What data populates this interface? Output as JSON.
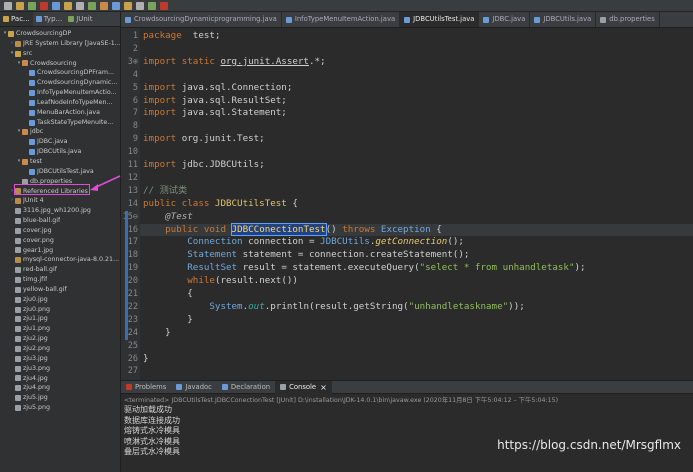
{
  "explorer": {
    "tabs": [
      {
        "label": "Pac...",
        "color": "#c9a24a"
      },
      {
        "label": "Typ...",
        "color": "#6a9bd8"
      },
      {
        "label": "JUnit",
        "color": "#7aa35a"
      }
    ],
    "tree": [
      {
        "depth": 0,
        "arrow": "▾",
        "icon": "project-icon",
        "color": "#c9a24a",
        "label": "CrowdsourcingDP"
      },
      {
        "depth": 1,
        "arrow": "›",
        "icon": "library-icon",
        "color": "#b88c4a",
        "label": "JRE System Library [JavaSE-1..."
      },
      {
        "depth": 1,
        "arrow": "▾",
        "icon": "folder-icon",
        "color": "#c9a24a",
        "label": "src"
      },
      {
        "depth": 2,
        "arrow": "▾",
        "icon": "package-icon",
        "color": "#c98a4a",
        "label": "Crowdsourcing"
      },
      {
        "depth": 3,
        "arrow": "",
        "icon": "java-file-icon",
        "color": "#6a9bd8",
        "label": "CrowdsourcingDPFram..."
      },
      {
        "depth": 3,
        "arrow": "",
        "icon": "java-file-icon",
        "color": "#6a9bd8",
        "label": "CrowdsourcingDynamic..."
      },
      {
        "depth": 3,
        "arrow": "",
        "icon": "java-file-icon",
        "color": "#6a9bd8",
        "label": "InfoTypeMenuItemActio..."
      },
      {
        "depth": 3,
        "arrow": "",
        "icon": "java-file-icon",
        "color": "#6a9bd8",
        "label": "LeafNodeInfoTypeMen..."
      },
      {
        "depth": 3,
        "arrow": "",
        "icon": "java-file-icon",
        "color": "#6a9bd8",
        "label": "MenuBarAction.java"
      },
      {
        "depth": 3,
        "arrow": "",
        "icon": "java-file-icon",
        "color": "#6a9bd8",
        "label": "TaskStateTypeMenuIte..."
      },
      {
        "depth": 2,
        "arrow": "▾",
        "icon": "package-icon",
        "color": "#c98a4a",
        "label": "jdbc"
      },
      {
        "depth": 3,
        "arrow": "",
        "icon": "java-file-icon",
        "color": "#6a9bd8",
        "label": "JDBC.java"
      },
      {
        "depth": 3,
        "arrow": "",
        "icon": "java-file-icon",
        "color": "#6a9bd8",
        "label": "JDBCUtils.java"
      },
      {
        "depth": 2,
        "arrow": "▾",
        "icon": "package-icon",
        "color": "#c98a4a",
        "label": "test"
      },
      {
        "depth": 3,
        "arrow": "",
        "icon": "java-file-icon",
        "color": "#6a9bd8",
        "label": "JDBCUtilsTest.java"
      },
      {
        "depth": 2,
        "arrow": "",
        "icon": "properties-file-icon",
        "color": "#9aa0a6",
        "label": "db.properties"
      },
      {
        "depth": 1,
        "arrow": "›",
        "icon": "library-icon",
        "color": "#b88c4a",
        "label": "Referenced Libraries"
      },
      {
        "depth": 1,
        "arrow": "›",
        "icon": "library-icon",
        "color": "#b88c4a",
        "label": "JUnit 4"
      },
      {
        "depth": 1,
        "arrow": "",
        "icon": "image-file-icon",
        "color": "#9aa0a6",
        "label": "3116.jpg_wh1200.jpg"
      },
      {
        "depth": 1,
        "arrow": "",
        "icon": "image-file-icon",
        "color": "#9aa0a6",
        "label": "blue-ball.gif"
      },
      {
        "depth": 1,
        "arrow": "",
        "icon": "image-file-icon",
        "color": "#9aa0a6",
        "label": "cover.jpg"
      },
      {
        "depth": 1,
        "arrow": "",
        "icon": "image-file-icon",
        "color": "#9aa0a6",
        "label": "cover.png"
      },
      {
        "depth": 1,
        "arrow": "",
        "icon": "image-file-icon",
        "color": "#9aa0a6",
        "label": "gear1.jpg"
      },
      {
        "depth": 1,
        "arrow": "",
        "icon": "jar-file-icon",
        "color": "#b88c4a",
        "label": "mysql-connector-java-8.0.21..."
      },
      {
        "depth": 1,
        "arrow": "",
        "icon": "image-file-icon",
        "color": "#9aa0a6",
        "label": "red-ball.gif"
      },
      {
        "depth": 1,
        "arrow": "",
        "icon": "image-file-icon",
        "color": "#9aa0a6",
        "label": "timg.jfif"
      },
      {
        "depth": 1,
        "arrow": "",
        "icon": "image-file-icon",
        "color": "#9aa0a6",
        "label": "yellow-ball.gif"
      },
      {
        "depth": 1,
        "arrow": "",
        "icon": "image-file-icon",
        "color": "#9aa0a6",
        "label": "zju0.jpg"
      },
      {
        "depth": 1,
        "arrow": "",
        "icon": "image-file-icon",
        "color": "#9aa0a6",
        "label": "zju0.png"
      },
      {
        "depth": 1,
        "arrow": "",
        "icon": "image-file-icon",
        "color": "#9aa0a6",
        "label": "zju1.jpg"
      },
      {
        "depth": 1,
        "arrow": "",
        "icon": "image-file-icon",
        "color": "#9aa0a6",
        "label": "zju1.png"
      },
      {
        "depth": 1,
        "arrow": "",
        "icon": "image-file-icon",
        "color": "#9aa0a6",
        "label": "zju2.jpg"
      },
      {
        "depth": 1,
        "arrow": "",
        "icon": "image-file-icon",
        "color": "#9aa0a6",
        "label": "zju2.png"
      },
      {
        "depth": 1,
        "arrow": "",
        "icon": "image-file-icon",
        "color": "#9aa0a6",
        "label": "zju3.jpg"
      },
      {
        "depth": 1,
        "arrow": "",
        "icon": "image-file-icon",
        "color": "#9aa0a6",
        "label": "zju3.png"
      },
      {
        "depth": 1,
        "arrow": "",
        "icon": "image-file-icon",
        "color": "#9aa0a6",
        "label": "zju4.jpg"
      },
      {
        "depth": 1,
        "arrow": "",
        "icon": "image-file-icon",
        "color": "#9aa0a6",
        "label": "zju4.png"
      },
      {
        "depth": 1,
        "arrow": "",
        "icon": "image-file-icon",
        "color": "#9aa0a6",
        "label": "zju5.jpg"
      },
      {
        "depth": 1,
        "arrow": "",
        "icon": "image-file-icon",
        "color": "#9aa0a6",
        "label": "zju5.png"
      }
    ],
    "highlight_color": "#e14bd6"
  },
  "editor_tabs": [
    {
      "label": "CrowdsourcingDynamicprogramming.java",
      "active": false
    },
    {
      "label": "InfoTypeMenuItemAction.java",
      "active": false
    },
    {
      "label": "JDBCUtilsTest.java",
      "active": true
    },
    {
      "label": "JDBC.java",
      "active": false
    },
    {
      "label": "JDBCUtils.java",
      "active": false
    },
    {
      "label": "db.properties",
      "active": false
    }
  ],
  "code": {
    "lines": [
      {
        "n": "1",
        "tokens": [
          [
            "kw",
            "package"
          ],
          [
            "",
            "  test;"
          ]
        ]
      },
      {
        "n": "2",
        "tokens": []
      },
      {
        "n": "3⊕",
        "tokens": [
          [
            "kw",
            "import static "
          ],
          [
            "ul",
            "org.junit.Assert"
          ],
          [
            "",
            ".*;"
          ]
        ]
      },
      {
        "n": "4",
        "tokens": []
      },
      {
        "n": "5",
        "tokens": [
          [
            "kw",
            "import"
          ],
          [
            "",
            " java.sql.Connection;"
          ]
        ]
      },
      {
        "n": "6",
        "tokens": [
          [
            "kw",
            "import"
          ],
          [
            "",
            " java.sql.ResultSet;"
          ]
        ]
      },
      {
        "n": "7",
        "tokens": [
          [
            "kw",
            "import"
          ],
          [
            "",
            " java.sql.Statement;"
          ]
        ]
      },
      {
        "n": "8",
        "tokens": []
      },
      {
        "n": "9",
        "tokens": [
          [
            "kw",
            "import"
          ],
          [
            "",
            " org.junit.Test;"
          ]
        ]
      },
      {
        "n": "10",
        "tokens": []
      },
      {
        "n": "11",
        "tokens": [
          [
            "kw",
            "import"
          ],
          [
            "",
            " jdbc.JDBCUtils;"
          ]
        ]
      },
      {
        "n": "12",
        "tokens": []
      },
      {
        "n": "13",
        "tokens": [
          [
            "cm",
            "// 测试类"
          ]
        ]
      },
      {
        "n": "14",
        "tokens": [
          [
            "kw",
            "public class "
          ],
          [
            "ty",
            "JDBCUtilsTest"
          ],
          [
            "",
            " {"
          ]
        ]
      },
      {
        "n": "15⊖",
        "tokens": [
          [
            "",
            "    "
          ],
          [
            "an",
            "@Test"
          ]
        ]
      },
      {
        "n": "16",
        "tokens": [
          [
            "",
            "    "
          ],
          [
            "kw",
            "public void "
          ],
          [
            "sel",
            "JDBCConectionTest"
          ],
          [
            "",
            "() "
          ],
          [
            "kw",
            "throws "
          ],
          [
            "cls",
            "Exception"
          ],
          [
            "",
            " {"
          ]
        ]
      },
      {
        "n": "17",
        "tokens": [
          [
            "",
            "        "
          ],
          [
            "cls",
            "Connection"
          ],
          [
            "",
            " connection = "
          ],
          [
            "cls",
            "JDBCUtils"
          ],
          [
            "",
            "."
          ],
          [
            "fn",
            "getConnection"
          ],
          [
            "",
            "();"
          ]
        ]
      },
      {
        "n": "18",
        "tokens": [
          [
            "",
            "        "
          ],
          [
            "cls",
            "Statement"
          ],
          [
            "",
            " statement = connection.createStatement();"
          ]
        ]
      },
      {
        "n": "19",
        "tokens": [
          [
            "",
            "        "
          ],
          [
            "cls",
            "ResultSet"
          ],
          [
            "",
            " result = statement.executeQuery("
          ],
          [
            "str",
            "\"select * from unhandletask\""
          ],
          [
            "",
            ");"
          ]
        ]
      },
      {
        "n": "20",
        "tokens": [
          [
            "",
            "        "
          ],
          [
            "kw",
            "while"
          ],
          [
            "",
            "(result.next())"
          ]
        ]
      },
      {
        "n": "21",
        "tokens": [
          [
            "",
            "        {"
          ]
        ]
      },
      {
        "n": "22",
        "tokens": [
          [
            "",
            "            "
          ],
          [
            "cls",
            "System"
          ],
          [
            "",
            "."
          ],
          [
            "sm",
            "out"
          ],
          [
            "",
            ".println(result.getString("
          ],
          [
            "str",
            "\"unhandletaskname\""
          ],
          [
            "",
            "));"
          ]
        ]
      },
      {
        "n": "23",
        "tokens": [
          [
            "",
            "        }"
          ]
        ]
      },
      {
        "n": "24",
        "tokens": [
          [
            "",
            "    }"
          ]
        ]
      },
      {
        "n": "25",
        "tokens": []
      },
      {
        "n": "26",
        "tokens": [
          [
            "",
            "}"
          ]
        ]
      },
      {
        "n": "27",
        "tokens": []
      }
    ]
  },
  "console": {
    "tabs": [
      {
        "label": "Problems",
        "color": "#c0392b",
        "active": false
      },
      {
        "label": "Javadoc",
        "color": "#6a9bd8",
        "active": false
      },
      {
        "label": "Declaration",
        "color": "#6a9bd8",
        "active": false
      },
      {
        "label": "Console",
        "color": "#9aa0a6",
        "active": true
      }
    ],
    "close_glyph": "×",
    "terminated": "<terminated> JDBCUtilsTest.JDBCConectionTest [JUnit] D:\\installation\\JDK-14.0.1\\bin\\javaw.exe  (2020年11月8日 下午5:04:12 – 下午5:04:15)",
    "output": [
      "驱动加载成功",
      "数据库连接成功",
      "熔铸式水冷模具",
      "喷淋式水冷模具",
      "叠层式水冷模具"
    ]
  },
  "watermark": "https://blog.csdn.net/Mrsgflmx"
}
